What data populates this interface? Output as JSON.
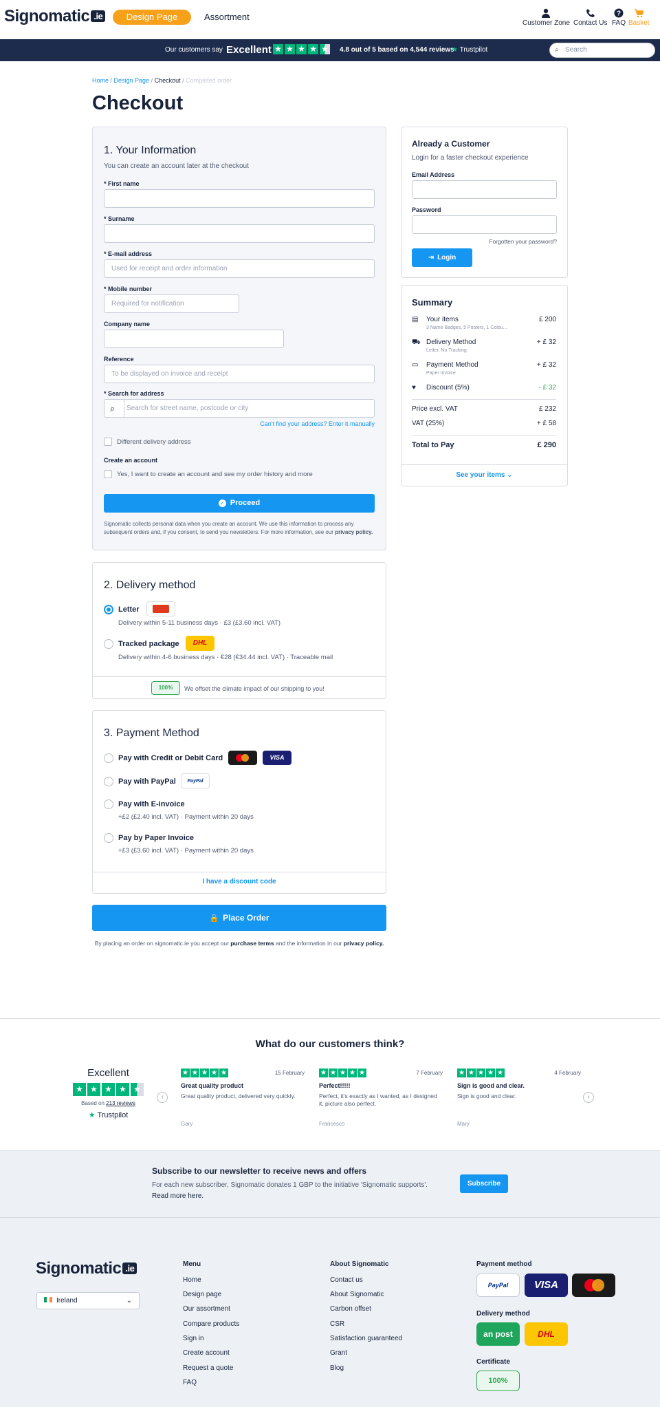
{
  "header": {
    "logo": "Signomatic",
    "logo_suffix": ".ie",
    "design_page": "Design Page",
    "assortment": "Assortment",
    "nav": [
      "Customer Zone",
      "Contact Us",
      "FAQ",
      "Basket"
    ]
  },
  "topbar": {
    "say": "Our customers say",
    "excellent": "Excellent",
    "rating": "4.8 out of 5 based on 4,544 reviews",
    "trustpilot": "Trustpilot",
    "search_placeholder": "Search"
  },
  "breadcrumb": [
    "Home",
    "Design Page",
    "Checkout",
    "Completed order"
  ],
  "page_title": "Checkout",
  "info": {
    "title": "1. Your Information",
    "subtitle": "You can create an account later at the checkout",
    "first_name": "* First name",
    "surname": "* Surname",
    "email": "* E-mail address",
    "email_ph": "Used for receipt and order information",
    "mobile": "* Mobile number",
    "mobile_ph": "Required for notification",
    "company": "Company name",
    "reference": "Reference",
    "reference_ph": "To be displayed on invoice and receipt",
    "address": "* Search for address",
    "address_ph": "Search for street name, postcode or city",
    "manual": "Can't find your address? Enter it manually",
    "diff_delivery": "Different delivery address",
    "create_account": "Create an account",
    "create_account_chk": "Yes, I want to create an account and see my order history and more",
    "proceed": "Proceed",
    "privacy_text": "Signomatic collects personal data when you create an account. We use this information to process any subsequent orders and, if you consent, to send you newsletters. For more information, see our",
    "privacy_link": "privacy policy."
  },
  "delivery": {
    "title": "2. Delivery method",
    "letter": "Letter",
    "letter_sub": "Delivery within 5-11 business days  ·  £3 (£3.60 incl. VAT)",
    "tracked": "Tracked package",
    "tracked_sub": "Delivery within 4-6 business days  ·  €28 (€34.44 incl. VAT)  ·  Traceable mail",
    "dhl": "DHL",
    "climate_badge": "100%",
    "climate": "We offset the climate impact of our shipping to you!"
  },
  "payment": {
    "title": "3. Payment Method",
    "card": "Pay with Credit or Debit Card",
    "visa": "VISA",
    "paypal": "Pay with PayPal",
    "paypal_logo": "PayPal",
    "einvoice": "Pay with E-invoice",
    "einvoice_sub": "+£2 (£2.40 incl. VAT)  ·  Payment within 20 days",
    "paper": "Pay by Paper Invoice",
    "paper_sub": "+£3 (£3.60 incl. VAT)  ·  Payment within 20 days",
    "discount": "I have a discount code"
  },
  "place_order": "Place Order",
  "terms": {
    "pre": "By placing an order on signomatic.ie you accept our",
    "terms_link": "purchase terms",
    "mid": "and the information in our",
    "privacy_link": "privacy policy."
  },
  "login": {
    "title": "Already a Customer",
    "subtitle": "Login for a faster checkout experience",
    "email": "Email Address",
    "password": "Password",
    "forgot": "Forgotten your password?",
    "button": "Login"
  },
  "summary": {
    "title": "Summary",
    "items": [
      {
        "label": "Your items",
        "sub": "3 Name Badges, 5 Posters, 1 Colou...",
        "value": "£ 200"
      },
      {
        "label": "Delivery Method",
        "sub": "Letter, No Tracking",
        "value": "+ £ 32"
      },
      {
        "label": "Payment Method",
        "sub": "Paper Invoice",
        "value": "+ £ 32"
      },
      {
        "label": "Discount (5%)",
        "sub": "",
        "value": "- £ 32"
      }
    ],
    "excl_label": "Price excl. VAT",
    "excl": "£ 232",
    "vat_label": "VAT (25%)",
    "vat": "+ £ 58",
    "total_label": "Total to Pay",
    "total": "£ 290",
    "see_items": "See your items"
  },
  "reviews": {
    "title": "What do our customers think?",
    "excellent": "Excellent",
    "based_on": "Based on",
    "count": "213 reviews",
    "trustpilot": "Trustpilot",
    "items": [
      {
        "date": "15 February",
        "title": "Great quality product",
        "body": "Great quality product, delivered very quickly.",
        "author": "Gary"
      },
      {
        "date": "7 February",
        "title": "Perfect!!!!!",
        "body": "Perfect, it's exactly as I wanted, as I designed it, picture also perfect.",
        "author": "Francesco"
      },
      {
        "date": "4 February",
        "title": "Sign is good and clear.",
        "body": "Sign is good and clear.",
        "author": "Mary"
      }
    ]
  },
  "newsletter": {
    "title": "Subscribe to our newsletter to receive news and offers",
    "body": "For each new subscriber, Signomatic donates 1 GBP to the initiative 'Signomatic supports'.",
    "more": "Read more here.",
    "button": "Subscribe"
  },
  "footer": {
    "country": "Ireland",
    "menu_title": "Menu",
    "menu": [
      "Home",
      "Design page",
      "Our assortment",
      "Compare products",
      "Sign in",
      "Create account",
      "Request a quote",
      "FAQ"
    ],
    "about_title": "About Signomatic",
    "about": [
      "Contact us",
      "About Signomatic",
      "Carbon offset",
      "CSR",
      "Satisfaction guaranteed",
      "Grant",
      "Blog"
    ],
    "payment_title": "Payment method",
    "paypal": "PayPal",
    "visa": "VISA",
    "delivery_title": "Delivery method",
    "anpost": "an post",
    "dhl": "DHL",
    "cert_title": "Certificate",
    "cert": "100%"
  }
}
